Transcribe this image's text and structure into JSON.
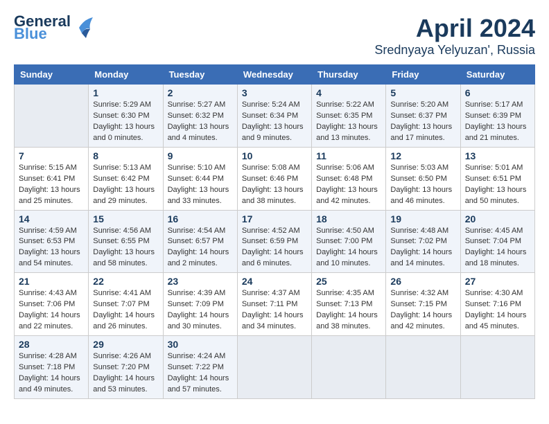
{
  "header": {
    "logo_line1": "General",
    "logo_line2": "Blue",
    "month_year": "April 2024",
    "location": "Srednyaya Yelyuzan', Russia"
  },
  "weekdays": [
    "Sunday",
    "Monday",
    "Tuesday",
    "Wednesday",
    "Thursday",
    "Friday",
    "Saturday"
  ],
  "weeks": [
    [
      {
        "day": "",
        "info": ""
      },
      {
        "day": "1",
        "info": "Sunrise: 5:29 AM\nSunset: 6:30 PM\nDaylight: 13 hours\nand 0 minutes."
      },
      {
        "day": "2",
        "info": "Sunrise: 5:27 AM\nSunset: 6:32 PM\nDaylight: 13 hours\nand 4 minutes."
      },
      {
        "day": "3",
        "info": "Sunrise: 5:24 AM\nSunset: 6:34 PM\nDaylight: 13 hours\nand 9 minutes."
      },
      {
        "day": "4",
        "info": "Sunrise: 5:22 AM\nSunset: 6:35 PM\nDaylight: 13 hours\nand 13 minutes."
      },
      {
        "day": "5",
        "info": "Sunrise: 5:20 AM\nSunset: 6:37 PM\nDaylight: 13 hours\nand 17 minutes."
      },
      {
        "day": "6",
        "info": "Sunrise: 5:17 AM\nSunset: 6:39 PM\nDaylight: 13 hours\nand 21 minutes."
      }
    ],
    [
      {
        "day": "7",
        "info": "Sunrise: 5:15 AM\nSunset: 6:41 PM\nDaylight: 13 hours\nand 25 minutes."
      },
      {
        "day": "8",
        "info": "Sunrise: 5:13 AM\nSunset: 6:42 PM\nDaylight: 13 hours\nand 29 minutes."
      },
      {
        "day": "9",
        "info": "Sunrise: 5:10 AM\nSunset: 6:44 PM\nDaylight: 13 hours\nand 33 minutes."
      },
      {
        "day": "10",
        "info": "Sunrise: 5:08 AM\nSunset: 6:46 PM\nDaylight: 13 hours\nand 38 minutes."
      },
      {
        "day": "11",
        "info": "Sunrise: 5:06 AM\nSunset: 6:48 PM\nDaylight: 13 hours\nand 42 minutes."
      },
      {
        "day": "12",
        "info": "Sunrise: 5:03 AM\nSunset: 6:50 PM\nDaylight: 13 hours\nand 46 minutes."
      },
      {
        "day": "13",
        "info": "Sunrise: 5:01 AM\nSunset: 6:51 PM\nDaylight: 13 hours\nand 50 minutes."
      }
    ],
    [
      {
        "day": "14",
        "info": "Sunrise: 4:59 AM\nSunset: 6:53 PM\nDaylight: 13 hours\nand 54 minutes."
      },
      {
        "day": "15",
        "info": "Sunrise: 4:56 AM\nSunset: 6:55 PM\nDaylight: 13 hours\nand 58 minutes."
      },
      {
        "day": "16",
        "info": "Sunrise: 4:54 AM\nSunset: 6:57 PM\nDaylight: 14 hours\nand 2 minutes."
      },
      {
        "day": "17",
        "info": "Sunrise: 4:52 AM\nSunset: 6:59 PM\nDaylight: 14 hours\nand 6 minutes."
      },
      {
        "day": "18",
        "info": "Sunrise: 4:50 AM\nSunset: 7:00 PM\nDaylight: 14 hours\nand 10 minutes."
      },
      {
        "day": "19",
        "info": "Sunrise: 4:48 AM\nSunset: 7:02 PM\nDaylight: 14 hours\nand 14 minutes."
      },
      {
        "day": "20",
        "info": "Sunrise: 4:45 AM\nSunset: 7:04 PM\nDaylight: 14 hours\nand 18 minutes."
      }
    ],
    [
      {
        "day": "21",
        "info": "Sunrise: 4:43 AM\nSunset: 7:06 PM\nDaylight: 14 hours\nand 22 minutes."
      },
      {
        "day": "22",
        "info": "Sunrise: 4:41 AM\nSunset: 7:07 PM\nDaylight: 14 hours\nand 26 minutes."
      },
      {
        "day": "23",
        "info": "Sunrise: 4:39 AM\nSunset: 7:09 PM\nDaylight: 14 hours\nand 30 minutes."
      },
      {
        "day": "24",
        "info": "Sunrise: 4:37 AM\nSunset: 7:11 PM\nDaylight: 14 hours\nand 34 minutes."
      },
      {
        "day": "25",
        "info": "Sunrise: 4:35 AM\nSunset: 7:13 PM\nDaylight: 14 hours\nand 38 minutes."
      },
      {
        "day": "26",
        "info": "Sunrise: 4:32 AM\nSunset: 7:15 PM\nDaylight: 14 hours\nand 42 minutes."
      },
      {
        "day": "27",
        "info": "Sunrise: 4:30 AM\nSunset: 7:16 PM\nDaylight: 14 hours\nand 45 minutes."
      }
    ],
    [
      {
        "day": "28",
        "info": "Sunrise: 4:28 AM\nSunset: 7:18 PM\nDaylight: 14 hours\nand 49 minutes."
      },
      {
        "day": "29",
        "info": "Sunrise: 4:26 AM\nSunset: 7:20 PM\nDaylight: 14 hours\nand 53 minutes."
      },
      {
        "day": "30",
        "info": "Sunrise: 4:24 AM\nSunset: 7:22 PM\nDaylight: 14 hours\nand 57 minutes."
      },
      {
        "day": "",
        "info": ""
      },
      {
        "day": "",
        "info": ""
      },
      {
        "day": "",
        "info": ""
      },
      {
        "day": "",
        "info": ""
      }
    ]
  ]
}
